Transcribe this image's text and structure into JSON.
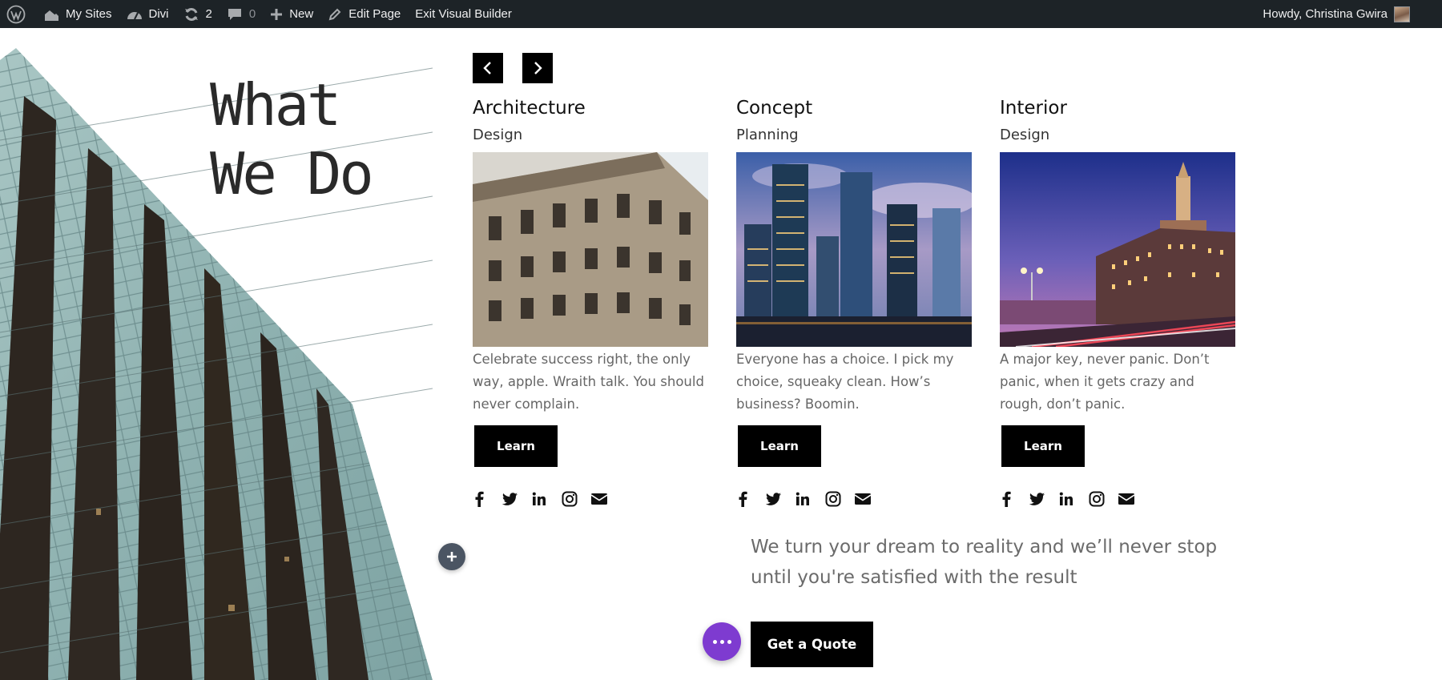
{
  "admin_bar": {
    "my_sites": "My Sites",
    "divi": "Divi",
    "updates_count": "2",
    "comments_count": "0",
    "new": "New",
    "edit_page": "Edit Page",
    "exit_builder": "Exit Visual Builder",
    "greeting": "Howdy, Christina Gwira"
  },
  "hero": {
    "headline_line1": "What",
    "headline_line2": "We Do"
  },
  "cards": [
    {
      "title": "Architecture",
      "subtitle": "Design",
      "text": " Celebrate success right, the only way, apple. Wraith talk. You should never complain.",
      "button": "Learn"
    },
    {
      "title": "Concept",
      "subtitle": "Planning",
      "text": "Everyone has a choice. I pick my choice, squeaky clean. How’s business? Boomin.",
      "button": "Learn"
    },
    {
      "title": "Interior",
      "subtitle": "Design",
      "text": "A major key, never panic. Don’t panic, when it gets crazy and rough, don’t panic.",
      "button": "Learn"
    }
  ],
  "cta": {
    "tagline_line1": "We turn your dream to reality and we’ll never stop",
    "tagline_line2": "until you're satisfied with the result",
    "button": "Get a Quote"
  },
  "colors": {
    "admin_bar_bg": "#1d2327",
    "accent_purple": "#7e3bd0",
    "button_black": "#000000",
    "add_button": "#4b5563"
  },
  "icons": {
    "arrows": [
      "chevron-left-icon",
      "chevron-right-icon"
    ],
    "socials": [
      "facebook-icon",
      "twitter-icon",
      "linkedin-icon",
      "instagram-icon",
      "email-icon"
    ]
  }
}
